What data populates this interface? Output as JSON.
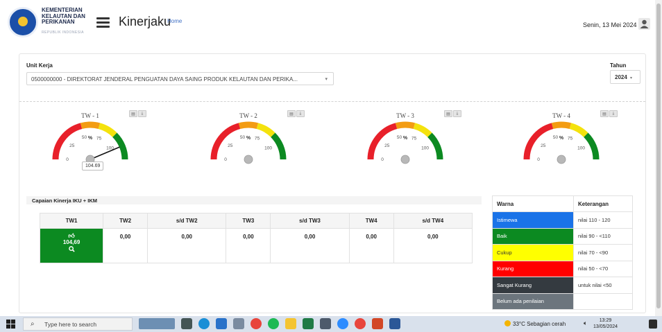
{
  "header": {
    "logo_lines": [
      "KEMENTERIAN",
      "KELAUTAN DAN",
      "PERIKANAN"
    ],
    "logo_sub": "REPUBLIK INDONESIA",
    "app_title": "Kinerjaku",
    "home_link": "Home",
    "date": "Senin, 13 Mei 2024"
  },
  "filters": {
    "unit_label": "Unit Kerja",
    "unit_value": "0500000000 - DIREKTORAT JENDERAL PENGUATAN DAYA SAING PRODUK KELAUTAN DAN PERIKA...",
    "year_label": "Tahun",
    "year_value": "2024"
  },
  "gauges": [
    {
      "title": "TW - 1",
      "unit": "%",
      "value": 104.69,
      "value_label": "104.69",
      "ticks": [
        "0",
        "25",
        "50",
        "75",
        "100"
      ]
    },
    {
      "title": "TW - 2",
      "unit": "%",
      "value": 0,
      "value_label": "",
      "ticks": [
        "0",
        "25",
        "50",
        "75",
        "100"
      ]
    },
    {
      "title": "TW - 3",
      "unit": "%",
      "value": 0,
      "value_label": "",
      "ticks": [
        "0",
        "25",
        "50",
        "75",
        "100"
      ]
    },
    {
      "title": "TW - 4",
      "unit": "%",
      "value": 0,
      "value_label": "",
      "ticks": [
        "0",
        "25",
        "50",
        "75",
        "100"
      ]
    }
  ],
  "capaian": {
    "title": "Capaian Kinerja IKU + IKM",
    "headers": [
      "TW1",
      "TW2",
      "s/d TW2",
      "TW3",
      "s/d TW3",
      "TW4",
      "s/d TW4"
    ],
    "tw1_value": "104,69",
    "values": [
      "0,00",
      "0,00",
      "0,00",
      "0,00",
      "0,00",
      "0,00"
    ]
  },
  "legend": {
    "header_color": "Warna",
    "header_desc": "Keterangan",
    "rows": [
      {
        "label": "Istimewa",
        "desc": "nilai 110 - 120",
        "color": "#1a73e8",
        "text_color": "#ffffff"
      },
      {
        "label": "Baik",
        "desc": "nilai 90 - <110",
        "color": "#0c8a21",
        "text_color": "#ffffff"
      },
      {
        "label": "Cukup",
        "desc": "nilai 70 - <90",
        "color": "#ffff00",
        "text_color": "#333333"
      },
      {
        "label": "Kurang",
        "desc": "nilai 50 - <70",
        "color": "#ff0000",
        "text_color": "#ffffff"
      },
      {
        "label": "Sangat Kurang",
        "desc": "untuk nilai <50",
        "color": "#343a40",
        "text_color": "#ffffff"
      },
      {
        "label": "Belum ada penilaian",
        "desc": "",
        "color": "#6c757d",
        "text_color": "#ffffff"
      }
    ]
  },
  "taskbar": {
    "search_placeholder": "Type here to search",
    "weather": "33°C  Sebagian cerah",
    "time": "13:29",
    "date": "13/05/2024",
    "apps": [
      "landscape-thumbnail",
      "task-view-icon",
      "edge-icon",
      "mail-icon",
      "app-icon",
      "chrome-icon",
      "spotify-icon",
      "file-explorer-icon",
      "excel-icon",
      "settings-icon",
      "zoom-icon",
      "chrome-icon",
      "powerpoint-icon",
      "word-icon"
    ]
  },
  "colors": {
    "gauge_red": "#e8202a",
    "gauge_orange": "#f39c12",
    "gauge_yellow": "#f4e20d",
    "gauge_green": "#0c8a21"
  }
}
